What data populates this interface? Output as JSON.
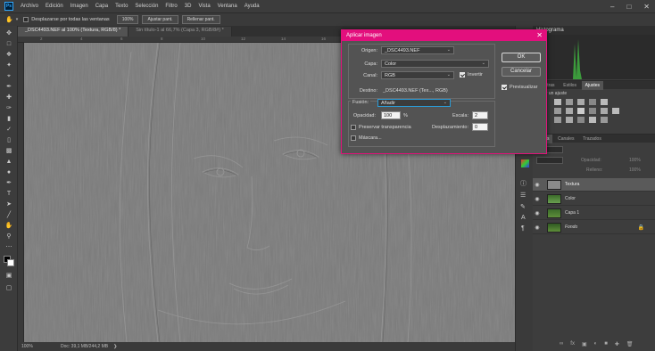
{
  "menubar": {
    "logo": "Ps",
    "items": [
      "Archivo",
      "Edición",
      "Imagen",
      "Capa",
      "Texto",
      "Selección",
      "Filtro",
      "3D",
      "Vista",
      "Ventana",
      "Ayuda"
    ]
  },
  "options_bar": {
    "scroll_all_label": "Desplazarse por todas las ventanas",
    "zoom_value": "100%",
    "fit_button": "Ajustar pant.",
    "fill_button": "Rellenar pant."
  },
  "document_tabs": [
    {
      "label": "_DSC4493.NEF al 100% (Textura, RGB/8) *",
      "active": true
    },
    {
      "label": "Sin título-1 al 66,7% (Capa 3, RGB/8#) *",
      "active": false
    }
  ],
  "ruler_ticks": [
    "2",
    "4",
    "6",
    "8",
    "10",
    "12",
    "14",
    "16",
    "18",
    "20",
    "22",
    "24"
  ],
  "status_bar": {
    "zoom": "100%",
    "doc_size": "Doc: 39,1 MB/244,2 MB"
  },
  "panels": {
    "color_tab": "Histograma",
    "adjust_tabs": [
      "Muestras",
      "Estilos",
      "Ajustes"
    ],
    "adjust_prompt": "Añadir un ajuste",
    "layer_tabs": [
      "Capas",
      "Canales",
      "Trazados"
    ],
    "opacity_label": "Opacidad:",
    "opacity_value": "100%",
    "fill_label": "Relleno:",
    "fill_value": "100%",
    "layers": [
      {
        "name": "Textura",
        "selected": true
      },
      {
        "name": "Color",
        "selected": false
      },
      {
        "name": "Capa 1",
        "selected": false
      },
      {
        "name": "Fondo",
        "selected": false,
        "locked": true
      }
    ]
  },
  "dialog": {
    "title": "Aplicar imagen",
    "source_label": "Origen:",
    "source_value": "_DSC4493.NEF",
    "layer_label": "Capa:",
    "layer_value": "Color",
    "channel_label": "Canal:",
    "channel_value": "RGB",
    "invert_label": "Invertir",
    "invert_checked": true,
    "target_label": "Destino:",
    "target_value": "_DSC4493.NEF (Tex..., RGB)",
    "blending_label": "Fusión:",
    "blending_value": "Añadir",
    "opacity_label": "Opacidad:",
    "opacity_value": "100",
    "opacity_unit": "%",
    "scale_label": "Escala:",
    "scale_value": "2",
    "offset_label": "Desplazamiento:",
    "offset_value": "0",
    "preserve_label": "Preservar transparencia",
    "mask_label": "Máscara...",
    "ok_label": "OK",
    "cancel_label": "Cancelar",
    "preview_label": "Previsualizar",
    "preview_checked": true
  },
  "colors": {
    "accent": "#e30f7d",
    "canvas": "#7b7b7b",
    "panel_bg": "#3d3d3d"
  }
}
